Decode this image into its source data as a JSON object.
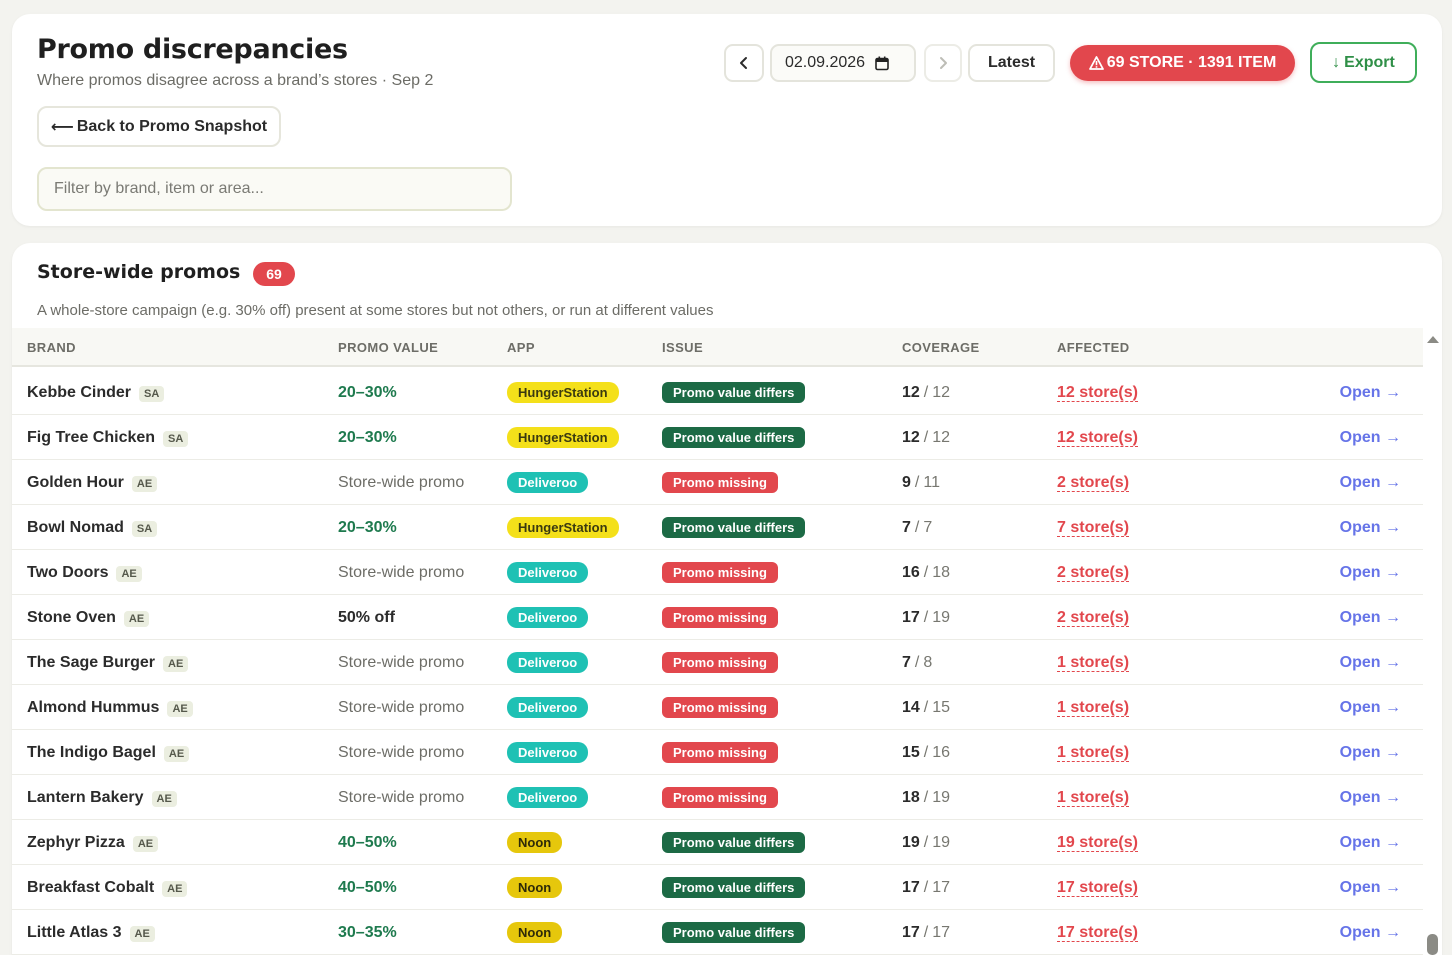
{
  "header": {
    "title": "Promo discrepancies",
    "subtitle": "Where promos disagree across a brand’s stores · Sep 2",
    "back_label": "Back to Promo Snapshot",
    "filter_placeholder": "Filter by brand, item or area...",
    "date_value": "02.09.2026",
    "latest_label": "Latest",
    "alert_label": "69 STORE · 1391 ITEM",
    "export_label": "Export"
  },
  "section": {
    "title": "Store-wide promos",
    "count": "69",
    "description": "A whole-store campaign (e.g. 30% off) present at some stores but not others, or run at different values",
    "columns": [
      "BRAND",
      "PROMO VALUE",
      "APP",
      "ISSUE",
      "COVERAGE",
      "AFFECTED"
    ],
    "open_label": "Open →"
  },
  "rows": [
    {
      "brand": "Kebbe Cinder",
      "region": "SA",
      "promo": "20–30%",
      "promo_style": "range",
      "app": "HungerStation",
      "issue": "Promo value differs",
      "cov_num": "12",
      "cov_total": "12",
      "affected": "12 store(s)"
    },
    {
      "brand": "Fig Tree Chicken",
      "region": "SA",
      "promo": "20–30%",
      "promo_style": "range",
      "app": "HungerStation",
      "issue": "Promo value differs",
      "cov_num": "12",
      "cov_total": "12",
      "affected": "12 store(s)"
    },
    {
      "brand": "Golden Hour",
      "region": "AE",
      "promo": "Store-wide promo",
      "promo_style": "plain",
      "app": "Deliveroo",
      "issue": "Promo missing",
      "cov_num": "9",
      "cov_total": "11",
      "affected": "2 store(s)"
    },
    {
      "brand": "Bowl Nomad",
      "region": "SA",
      "promo": "20–30%",
      "promo_style": "range",
      "app": "HungerStation",
      "issue": "Promo value differs",
      "cov_num": "7",
      "cov_total": "7",
      "affected": "7 store(s)"
    },
    {
      "brand": "Two Doors",
      "region": "AE",
      "promo": "Store-wide promo",
      "promo_style": "plain",
      "app": "Deliveroo",
      "issue": "Promo missing",
      "cov_num": "16",
      "cov_total": "18",
      "affected": "2 store(s)"
    },
    {
      "brand": "Stone Oven",
      "region": "AE",
      "promo": "50% off",
      "promo_style": "dark",
      "app": "Deliveroo",
      "issue": "Promo missing",
      "cov_num": "17",
      "cov_total": "19",
      "affected": "2 store(s)"
    },
    {
      "brand": "The Sage Burger",
      "region": "AE",
      "promo": "Store-wide promo",
      "promo_style": "plain",
      "app": "Deliveroo",
      "issue": "Promo missing",
      "cov_num": "7",
      "cov_total": "8",
      "affected": "1 store(s)"
    },
    {
      "brand": "Almond Hummus",
      "region": "AE",
      "promo": "Store-wide promo",
      "promo_style": "plain",
      "app": "Deliveroo",
      "issue": "Promo missing",
      "cov_num": "14",
      "cov_total": "15",
      "affected": "1 store(s)"
    },
    {
      "brand": "The Indigo Bagel",
      "region": "AE",
      "promo": "Store-wide promo",
      "promo_style": "plain",
      "app": "Deliveroo",
      "issue": "Promo missing",
      "cov_num": "15",
      "cov_total": "16",
      "affected": "1 store(s)"
    },
    {
      "brand": "Lantern Bakery",
      "region": "AE",
      "promo": "Store-wide promo",
      "promo_style": "plain",
      "app": "Deliveroo",
      "issue": "Promo missing",
      "cov_num": "18",
      "cov_total": "19",
      "affected": "1 store(s)"
    },
    {
      "brand": "Zephyr Pizza",
      "region": "AE",
      "promo": "40–50%",
      "promo_style": "range",
      "app": "Noon",
      "issue": "Promo value differs",
      "cov_num": "19",
      "cov_total": "19",
      "affected": "19 store(s)"
    },
    {
      "brand": "Breakfast Cobalt",
      "region": "AE",
      "promo": "40–50%",
      "promo_style": "range",
      "app": "Noon",
      "issue": "Promo value differs",
      "cov_num": "17",
      "cov_total": "17",
      "affected": "17 store(s)"
    },
    {
      "brand": "Little Atlas 3",
      "region": "AE",
      "promo": "30–35%",
      "promo_style": "range",
      "app": "Noon",
      "issue": "Promo value differs",
      "cov_num": "17",
      "cov_total": "17",
      "affected": "17 store(s)"
    }
  ],
  "colors": {
    "accent_red": "#e2474d",
    "accent_green": "#3fae5a",
    "range_green": "#1e7a4e",
    "link_blue": "#6674e8",
    "hungerstation": "#f4e01a",
    "deliveroo": "#1fc1b4",
    "noon": "#e6c70c"
  }
}
